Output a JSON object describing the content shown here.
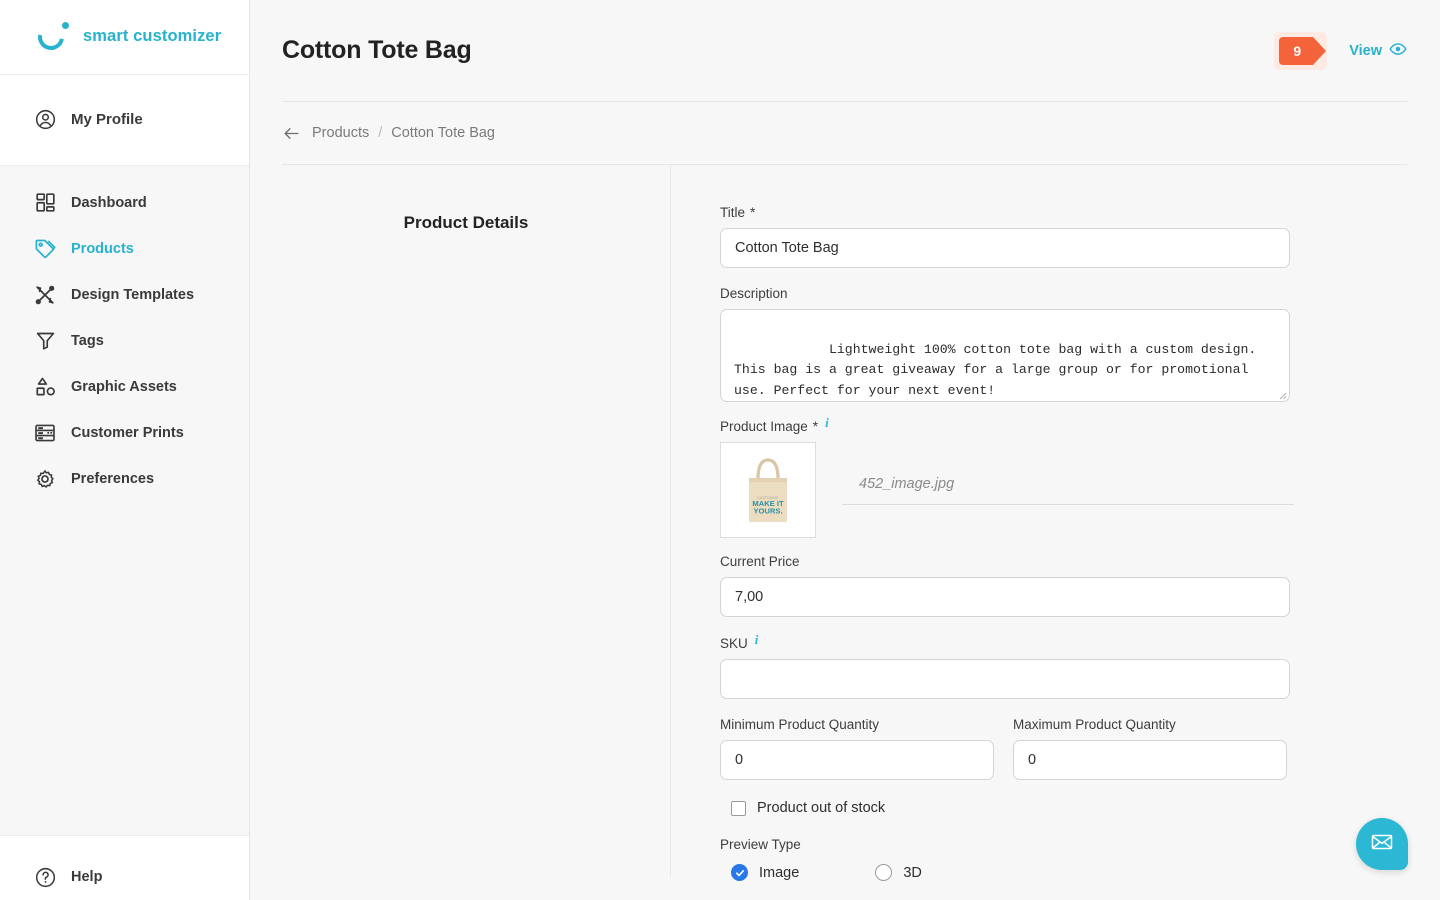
{
  "brand": {
    "name": "smart customizer",
    "accent": "#27b2cd",
    "logo_icon": "circle-dot-logo-icon"
  },
  "sidebar": {
    "profile": {
      "label": "My Profile",
      "icon": "user-circle-icon"
    },
    "items": [
      {
        "label": "Dashboard",
        "icon": "grid-icon",
        "active": false
      },
      {
        "label": "Products",
        "icon": "tag-icon",
        "active": true
      },
      {
        "label": "Design Templates",
        "icon": "design-tools-icon",
        "active": false
      },
      {
        "label": "Tags",
        "icon": "filter-icon",
        "active": false
      },
      {
        "label": "Graphic Assets",
        "icon": "shapes-icon",
        "active": false
      },
      {
        "label": "Customer Prints",
        "icon": "print-layout-icon",
        "active": false
      },
      {
        "label": "Preferences",
        "icon": "gear-icon",
        "active": false
      }
    ],
    "help": {
      "label": "Help",
      "icon": "question-circle-icon"
    }
  },
  "header": {
    "title": "Cotton Tote Bag",
    "badge_count": "9",
    "badge_color": "#f4633a",
    "view_label": "View",
    "view_icon": "eye-icon"
  },
  "breadcrumb": {
    "back_icon": "arrow-left-icon",
    "parent": "Products",
    "separator": "/",
    "current": "Cotton Tote Bag"
  },
  "panel": {
    "heading": "Product Details"
  },
  "form": {
    "title": {
      "label": "Title",
      "required": "*",
      "value": "Cotton Tote Bag",
      "placeholder": ""
    },
    "description": {
      "label": "Description",
      "value": "Lightweight 100% cotton tote bag with a custom design. This bag is a great giveaway for a large group or for promotional use. Perfect for your next event!",
      "placeholder": ""
    },
    "product_image": {
      "label": "Product Image",
      "required": "*",
      "info_icon": "info-icon",
      "file_name": "452_image.jpg",
      "thumb_alt": "cotton-tote-bag-thumbnail",
      "thumb_print_line1": "MAKE IT",
      "thumb_print_line2": "YOURS."
    },
    "current_price": {
      "label": "Current Price",
      "value": "7,00",
      "placeholder": ""
    },
    "sku": {
      "label": "SKU",
      "info_icon": "info-icon",
      "value": "",
      "placeholder": ""
    },
    "min_quantity": {
      "label": "Minimum Product Quantity",
      "value": "0",
      "placeholder": ""
    },
    "max_quantity": {
      "label": "Maximum Product Quantity",
      "value": "0",
      "placeholder": ""
    },
    "out_of_stock": {
      "label": "Product out of stock",
      "checked": false
    },
    "preview_type": {
      "label": "Preview Type",
      "options": [
        {
          "label": "Image",
          "selected": true
        },
        {
          "label": "3D",
          "selected": false
        }
      ],
      "selected_color": "#2878e8"
    }
  },
  "chat": {
    "icon": "envelope-icon",
    "color": "#2cb8d4"
  }
}
